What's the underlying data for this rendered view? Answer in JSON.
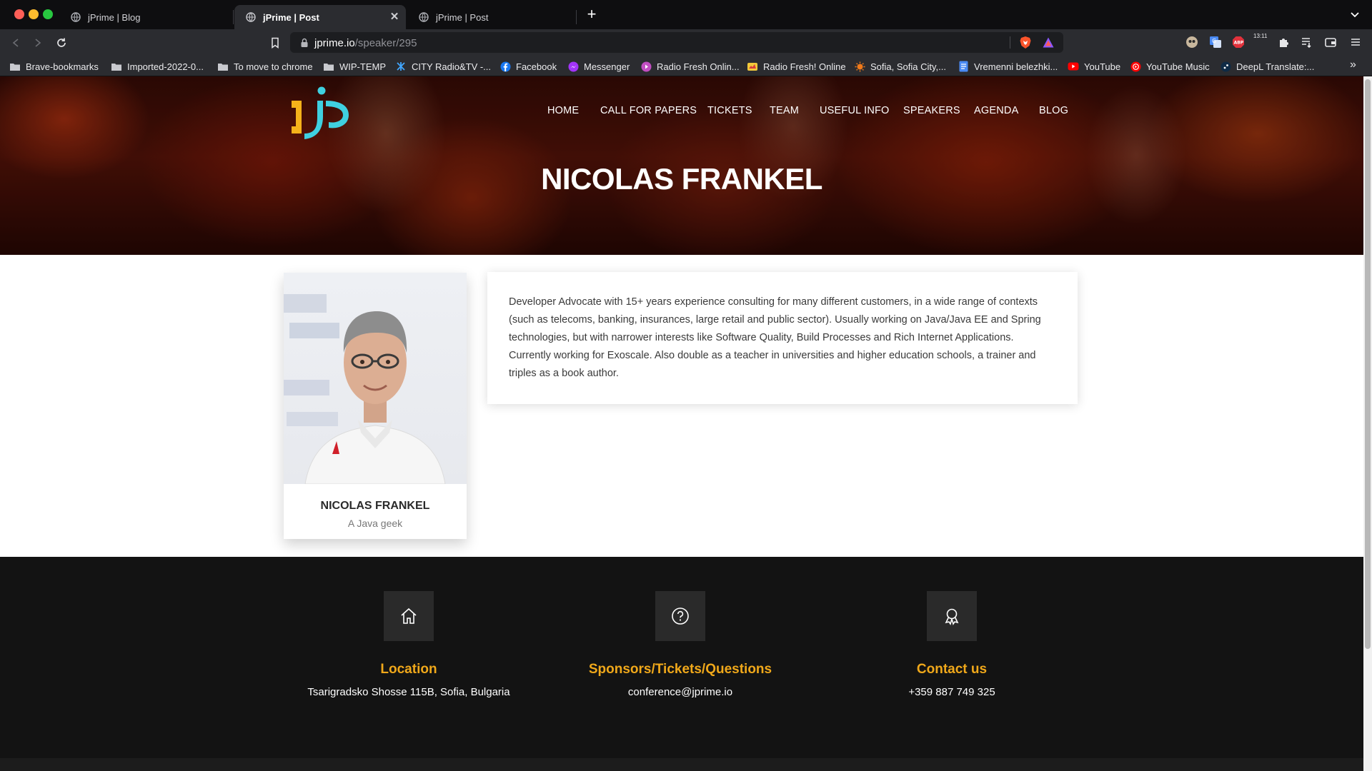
{
  "browser": {
    "tabs": [
      {
        "title": "jPrime | Blog",
        "active": false
      },
      {
        "title": "jPrime | Post",
        "active": true
      },
      {
        "title": "jPrime | Post",
        "active": false
      }
    ],
    "new_tab": "+",
    "url_host": "jprime.io",
    "url_path": "/speaker/295",
    "clock": "13:11",
    "bookmarks": [
      {
        "label": "Brave-bookmarks",
        "icon": "folder-icon"
      },
      {
        "label": "Imported-2022-0...",
        "icon": "folder-icon"
      },
      {
        "label": "To move to chrome",
        "icon": "folder-icon"
      },
      {
        "label": "WIP-TEMP",
        "icon": "folder-icon"
      },
      {
        "label": "CITY Radio&TV -...",
        "icon": "city-radio-icon"
      },
      {
        "label": "Facebook",
        "icon": "facebook-icon"
      },
      {
        "label": "Messenger",
        "icon": "messenger-icon"
      },
      {
        "label": "Radio Fresh Onlin...",
        "icon": "radio-fresh-icon"
      },
      {
        "label": "Radio Fresh! Online",
        "icon": "radio-fresh-alt-icon"
      },
      {
        "label": "Sofia, Sofia City,...",
        "icon": "weather-icon"
      },
      {
        "label": "Vremenni belezhki...",
        "icon": "docs-icon"
      },
      {
        "label": "YouTube",
        "icon": "youtube-icon"
      },
      {
        "label": "YouTube Music",
        "icon": "youtube-music-icon"
      },
      {
        "label": "DeepL Translate:...",
        "icon": "deepl-icon"
      }
    ],
    "more_bookmarks": "»"
  },
  "site": {
    "nav": [
      "HOME",
      "CALL FOR PAPERS",
      "TICKETS",
      "TEAM",
      "USEFUL INFO",
      "SPEAKERS",
      "AGENDA",
      "BLOG"
    ],
    "page_title": "NICOLAS FRANKEL",
    "speaker": {
      "name": "NICOLAS FRANKEL",
      "tagline": "A Java geek",
      "bio": "Developer Advocate with 15+ years experience consulting for many different customers, in a wide range of contexts (such as telecoms, banking, insurances, large retail and public sector). Usually working on Java/Java EE and Spring technologies, but with narrower interests like Software Quality, Build Processes and Rich Internet Applications. Currently working for Exoscale. Also double as a teacher in universities and higher education schools, a trainer and triples as a book author."
    },
    "footer": {
      "location": {
        "title": "Location",
        "text": "Tsarigradsko Shosse 115B, Sofia, Bulgaria",
        "icon": "home-icon"
      },
      "questions": {
        "title": "Sponsors/Tickets/Questions",
        "text": "conference@jprime.io",
        "icon": "question-icon"
      },
      "contact": {
        "title": "Contact us",
        "text": "+359 887 749 325",
        "icon": "award-icon"
      }
    },
    "colors": {
      "accent": "#f0a81a",
      "footer_bg": "#131313",
      "logo_yellow": "#f5b21a",
      "logo_cyan": "#3fd0e0"
    }
  }
}
